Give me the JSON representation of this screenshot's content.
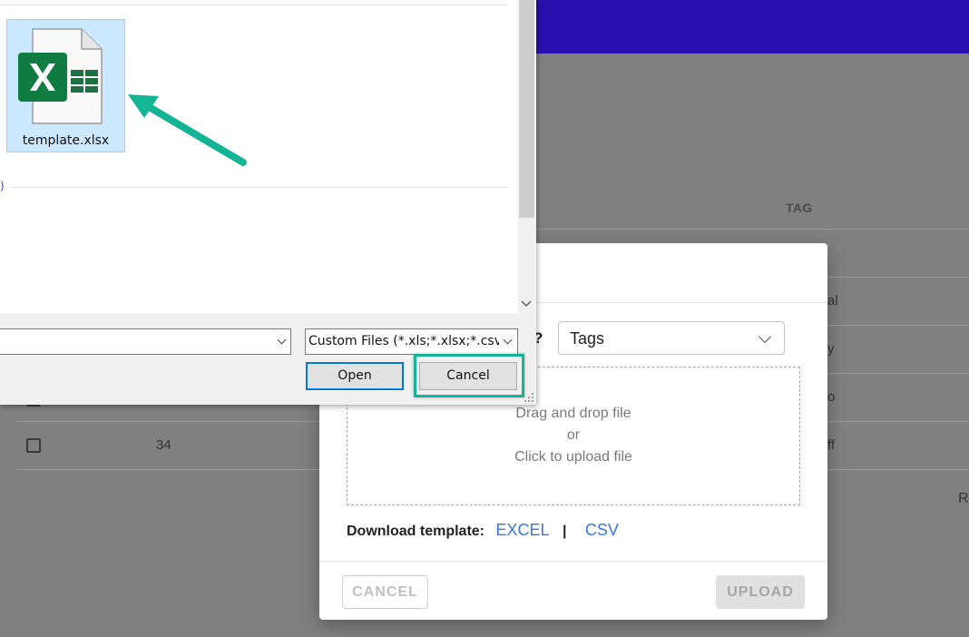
{
  "background_page": {
    "table_header_tag": "TAG",
    "rows": [
      {
        "id": "",
        "tag_fragment": "al"
      },
      {
        "id": "",
        "tag_fragment": "y"
      },
      {
        "id": "",
        "tag_fragment": "o"
      },
      {
        "id": "34",
        "tag_fragment": "ff"
      }
    ],
    "pagination_fragment": "R"
  },
  "upload_modal": {
    "question_fragment": "?",
    "select_value": "Tags",
    "dropzone": {
      "line1": "Drag and drop file",
      "line2": "or",
      "line3": "Click to upload file"
    },
    "download_template_label": "Download template:",
    "excel_link": "EXCEL",
    "separator": "|",
    "csv_link": "CSV",
    "cancel_label": "CANCEL",
    "upload_label": "UPLOAD"
  },
  "file_dialog": {
    "file_name": "template.xlsx",
    "file_icon": "excel-file-icon",
    "group_fragment": ")",
    "file_name_input": "",
    "file_type_filter": "Custom Files (*.xls;*.xlsx;*.csv;*.xl",
    "open_label": "Open",
    "cancel_label": "Cancel"
  },
  "annotation": {
    "highlight_color": "#14b595",
    "arrow_color": "#14b595"
  }
}
